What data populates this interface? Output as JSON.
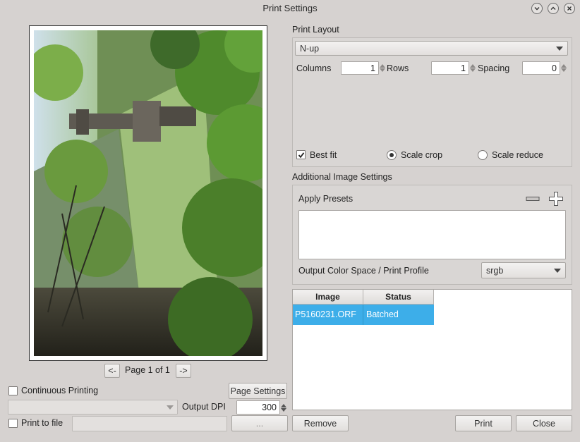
{
  "window": {
    "title": "Print Settings"
  },
  "preview": {
    "prev_label": "<-",
    "next_label": "->",
    "page_label": "Page 1",
    "of_label": "of 1"
  },
  "options": {
    "continuous_printing_label": "Continuous Printing",
    "continuous_printing_checked": false,
    "page_settings_label": "Page Settings",
    "printer_select_value": "",
    "output_dpi_label": "Output DPI",
    "output_dpi_value": "300",
    "print_to_file_label": "Print to file",
    "print_to_file_checked": false,
    "file_path_value": "",
    "browse_label": "..."
  },
  "print_layout": {
    "heading": "Print Layout",
    "layout_select_value": "N-up",
    "columns_label": "Columns",
    "columns_value": "1",
    "rows_label": "Rows",
    "rows_value": "1",
    "spacing_label": "Spacing",
    "spacing_value": "0",
    "best_fit_label": "Best fit",
    "best_fit_checked": true,
    "scale_crop_label": "Scale crop",
    "scale_crop_selected": true,
    "scale_reduce_label": "Scale reduce",
    "scale_reduce_selected": false
  },
  "additional": {
    "heading": "Additional Image Settings",
    "apply_presets_label": "Apply Presets",
    "color_space_label": "Output Color Space / Print Profile",
    "color_space_value": "srgb"
  },
  "table": {
    "columns": [
      "Image",
      "Status"
    ],
    "rows": [
      {
        "image": "P5160231.ORF",
        "status": "Batched",
        "selected": true
      }
    ]
  },
  "buttons": {
    "remove_label": "Remove",
    "print_label": "Print",
    "close_label": "Close"
  },
  "colors": {
    "window_bg": "#d6d2d0",
    "selection": "#3daee9"
  }
}
